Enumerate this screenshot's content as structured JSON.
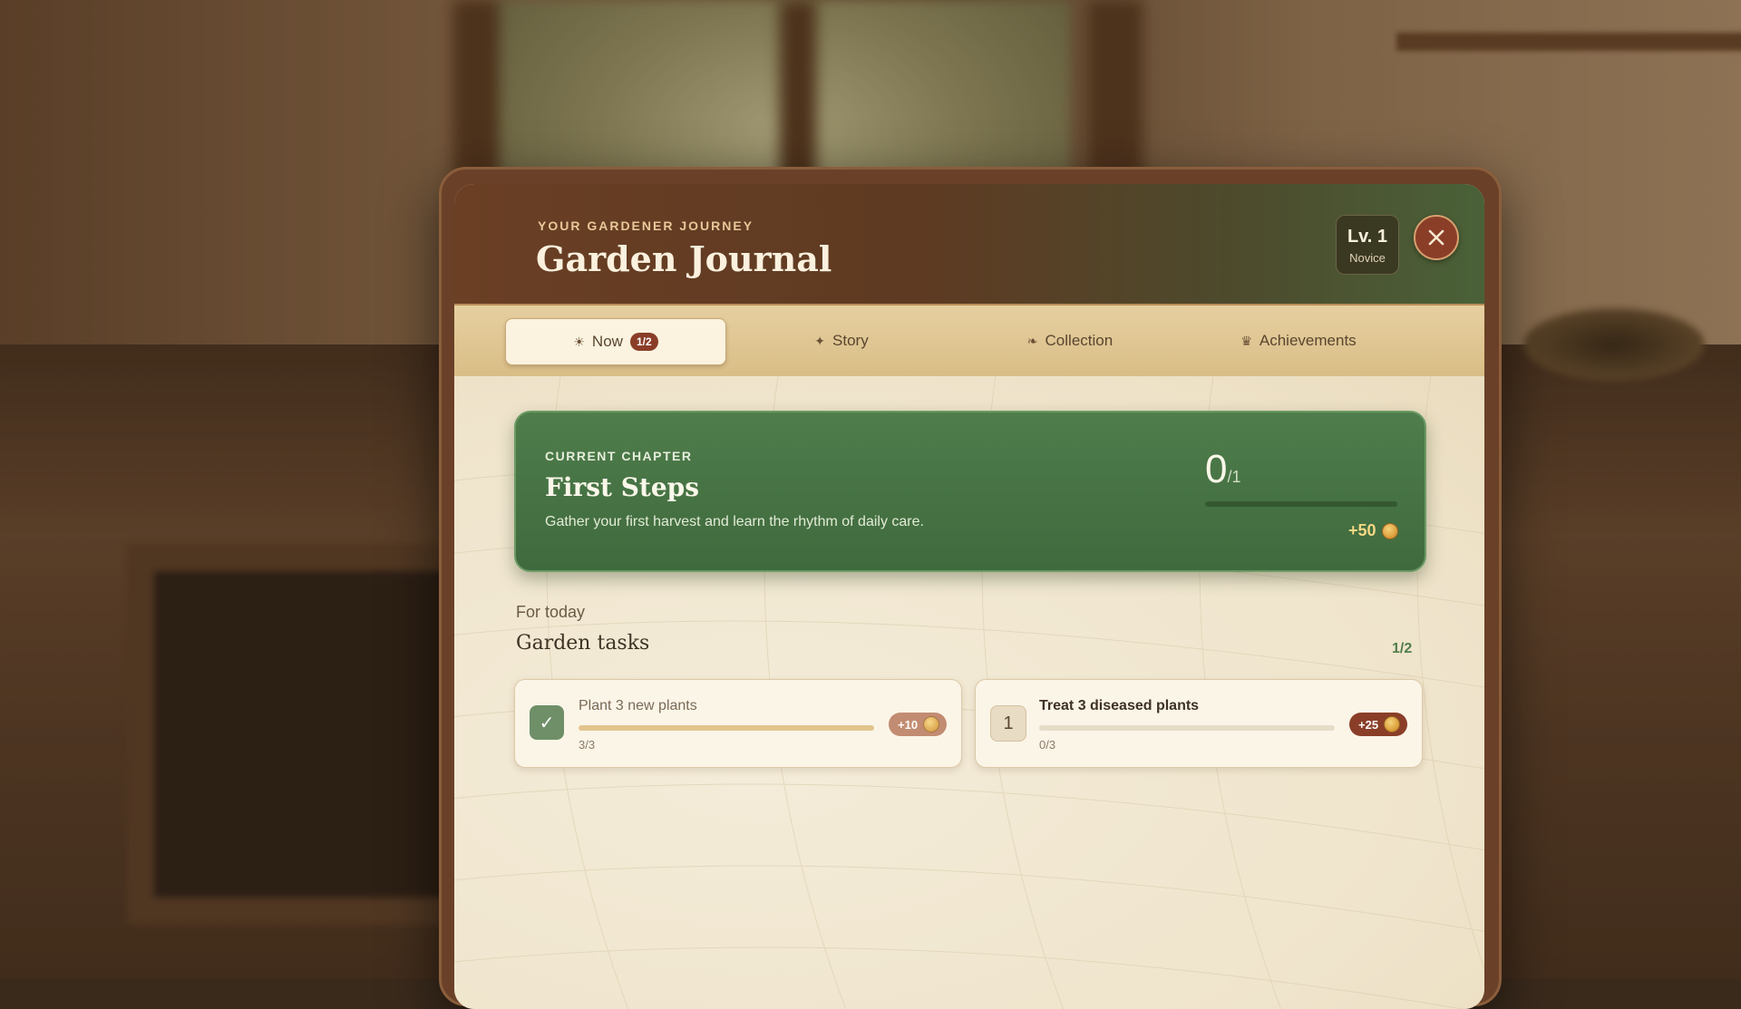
{
  "header": {
    "kicker": "YOUR GARDENER JOURNEY",
    "title": "Garden Journal",
    "level_label": "Lv. 1",
    "rank": "Novice",
    "close_icon": "close-icon"
  },
  "tabs": [
    {
      "label": "Now",
      "icon": "sun-icon",
      "badge": "1/2",
      "active": true
    },
    {
      "label": "Story",
      "icon": "sparkle-icon",
      "active": false
    },
    {
      "label": "Collection",
      "icon": "sprout-icon",
      "active": false
    },
    {
      "label": "Achievements",
      "icon": "trophy-icon",
      "active": false
    }
  ],
  "chapter": {
    "kicker": "CURRENT CHAPTER",
    "title": "First Steps",
    "description": "Gather your first harvest and learn the rhythm of daily care.",
    "progress_current": "0",
    "progress_total": "/1",
    "progress_fraction": 0,
    "reward": "+50"
  },
  "tasks_section": {
    "subtitle": "For today",
    "title": "Garden tasks",
    "count": "1/2"
  },
  "tasks": [
    {
      "name": "Plant 3 new plants",
      "progress": "3/3",
      "fraction": 1.0,
      "done": true,
      "mark": "✓",
      "reward": "+10"
    },
    {
      "name": "Treat 3 diseased plants",
      "progress": "0/3",
      "fraction": 0.0,
      "done": false,
      "mark": "1",
      "reward": "+25"
    }
  ],
  "colors": {
    "accent_green": "#4f7d4b",
    "accent_brown": "#8a3e28",
    "gold": "#f3d884"
  }
}
